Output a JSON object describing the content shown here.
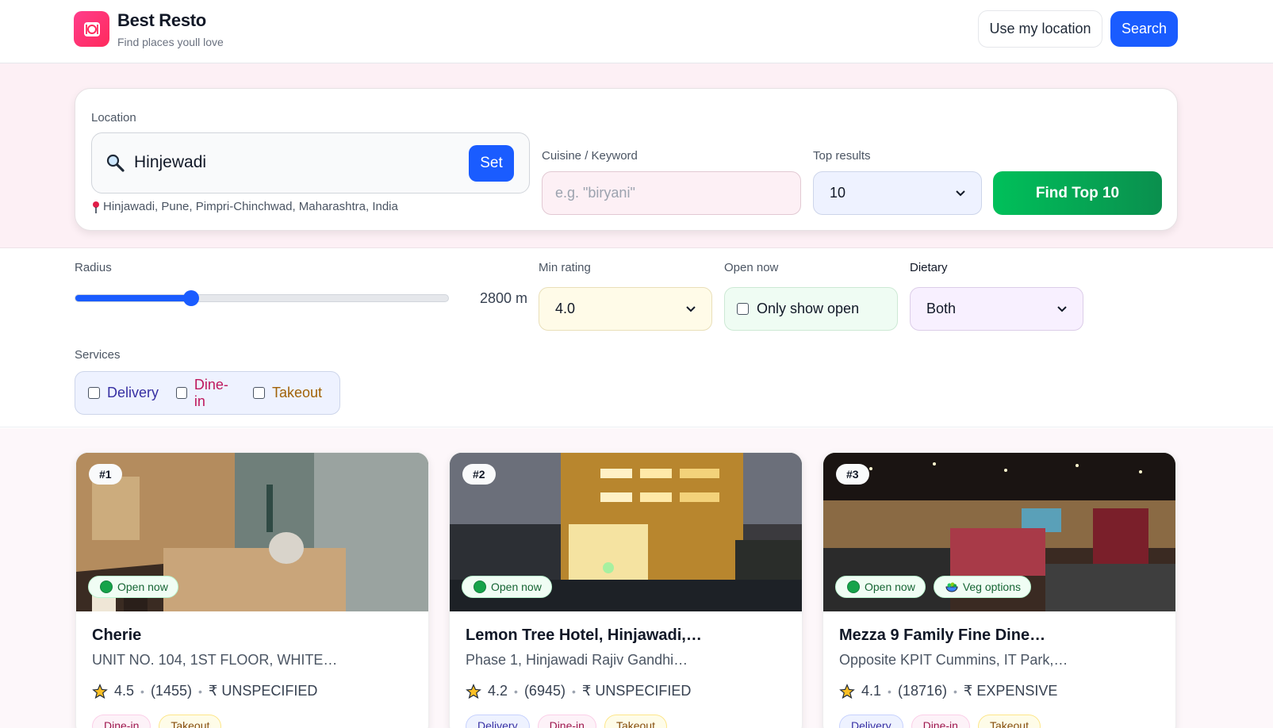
{
  "header": {
    "brand_title": "Best Resto",
    "brand_subtitle": "Find places youll love",
    "use_location_label": "Use my location",
    "search_label": "Search"
  },
  "search": {
    "location_label": "Location",
    "location_value": "Hinjewadi",
    "set_label": "Set",
    "resolved_location": "Hinjawadi, Pune, Pimpri-Chinchwad, Maharashtra, India",
    "keyword_label": "Cuisine / Keyword",
    "keyword_placeholder": "e.g. \"biryani\"",
    "top_results_label": "Top results",
    "top_results_value": "10",
    "find_label": "Find Top 10"
  },
  "filters": {
    "radius_label": "Radius",
    "radius_value": "2800 m",
    "radius_fraction": 0.31,
    "min_rating_label": "Min rating",
    "min_rating_value": "4.0",
    "open_now_label": "Open now",
    "open_now_option": "Only show open",
    "dietary_label": "Dietary",
    "dietary_value": "Both",
    "services_label": "Services",
    "services": [
      {
        "label": "Delivery",
        "color": "#3730a3"
      },
      {
        "label": "Dine-in",
        "color": "#be185d"
      },
      {
        "label": "Takeout",
        "color": "#a16207"
      }
    ]
  },
  "results": [
    {
      "rank": "#1",
      "open_label": "Open now",
      "veg_label": "",
      "name": "Cherie",
      "address": "UNIT NO. 104, 1ST FLOOR, WHITE…",
      "rating": "4.5",
      "reviews": "(1455)",
      "price": "₹ UNSPECIFIED",
      "tags": [
        "Dine-in",
        "Takeout"
      ]
    },
    {
      "rank": "#2",
      "open_label": "Open now",
      "veg_label": "",
      "name": "Lemon Tree Hotel, Hinjawadi,…",
      "address": "Phase 1, Hinjawadi Rajiv Gandhi…",
      "rating": "4.2",
      "reviews": "(6945)",
      "price": "₹ UNSPECIFIED",
      "tags": [
        "Delivery",
        "Dine-in",
        "Takeout"
      ]
    },
    {
      "rank": "#3",
      "open_label": "Open now",
      "veg_label": "Veg options",
      "name": "Mezza 9 Family Fine Dine…",
      "address": "Opposite KPIT Cummins, IT Park,…",
      "rating": "4.1",
      "reviews": "(18716)",
      "price": "₹ EXPENSIVE",
      "tags": [
        "Delivery",
        "Dine-in",
        "Takeout"
      ]
    }
  ],
  "colors": {
    "accent": "#1a5cff",
    "find_green": "#00c05a",
    "logo_pink": "#ff3d8b"
  }
}
